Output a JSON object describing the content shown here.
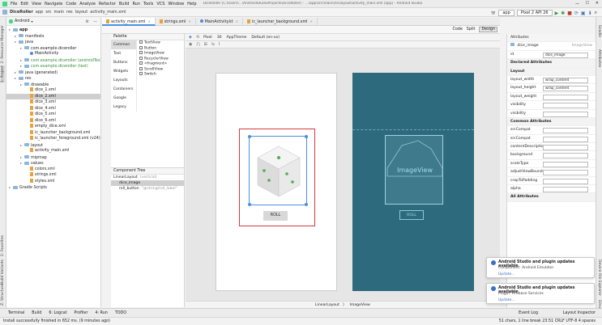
{
  "window_title": "DiceRoller [C:\\Users\\...\\AndroidStudioProjects\\DiceRoller] - ...\\app\\src\\main\\res\\layout\\activity_main.xml [app] - Android Studio",
  "menu": [
    "File",
    "Edit",
    "View",
    "Navigate",
    "Code",
    "Analyze",
    "Refactor",
    "Build",
    "Run",
    "Tools",
    "VCS",
    "Window",
    "Help"
  ],
  "breadcrumbs": [
    "DiceRoller",
    "app",
    "src",
    "main",
    "res",
    "layout",
    "activity_main.xml"
  ],
  "toolbar": {
    "run_config": "app",
    "device": "Pixel 2 API 26"
  },
  "project_panel": {
    "view_mode": "Android",
    "tree": [
      {
        "label": "app",
        "indent": 0,
        "kind": "folder",
        "bold": true
      },
      {
        "label": "manifests",
        "indent": 1,
        "kind": "folder"
      },
      {
        "label": "java",
        "indent": 1,
        "kind": "folder"
      },
      {
        "label": "com.example.diceroller",
        "indent": 2,
        "kind": "folder"
      },
      {
        "label": "MainActivity",
        "indent": 3,
        "kind": "kt"
      },
      {
        "label": "com.example.diceroller (androidTest)",
        "indent": 2,
        "kind": "folder",
        "green": true
      },
      {
        "label": "com.example.diceroller (test)",
        "indent": 2,
        "kind": "folder",
        "green": true
      },
      {
        "label": "java (generated)",
        "indent": 1,
        "kind": "folder"
      },
      {
        "label": "res",
        "indent": 1,
        "kind": "folder"
      },
      {
        "label": "drawable",
        "indent": 2,
        "kind": "folder"
      },
      {
        "label": "dice_1.xml",
        "indent": 3,
        "kind": "xml"
      },
      {
        "label": "dice_2.xml",
        "indent": 3,
        "kind": "xml",
        "selected": true
      },
      {
        "label": "dice_3.xml",
        "indent": 3,
        "kind": "xml"
      },
      {
        "label": "dice_4.xml",
        "indent": 3,
        "kind": "xml"
      },
      {
        "label": "dice_5.xml",
        "indent": 3,
        "kind": "xml"
      },
      {
        "label": "dice_6.xml",
        "indent": 3,
        "kind": "xml"
      },
      {
        "label": "empty_dice.xml",
        "indent": 3,
        "kind": "xml"
      },
      {
        "label": "ic_launcher_background.xml",
        "indent": 3,
        "kind": "xml"
      },
      {
        "label": "ic_launcher_foreground.xml (v24)",
        "indent": 3,
        "kind": "xml"
      },
      {
        "label": "layout",
        "indent": 2,
        "kind": "folder"
      },
      {
        "label": "activity_main.xml",
        "indent": 3,
        "kind": "xml"
      },
      {
        "label": "mipmap",
        "indent": 2,
        "kind": "folder"
      },
      {
        "label": "values",
        "indent": 2,
        "kind": "folder"
      },
      {
        "label": "colors.xml",
        "indent": 3,
        "kind": "xml"
      },
      {
        "label": "strings.xml",
        "indent": 3,
        "kind": "xml"
      },
      {
        "label": "styles.xml",
        "indent": 3,
        "kind": "xml"
      },
      {
        "label": "Gradle Scripts",
        "indent": 0,
        "kind": "folder"
      }
    ]
  },
  "editor_tabs": [
    {
      "label": "activity_main.xml",
      "active": true
    },
    {
      "label": "strings.xml"
    },
    {
      "label": "MainActivity.kt"
    },
    {
      "label": "ic_launcher_background.xml"
    }
  ],
  "view_modes": [
    "Code",
    "Split",
    "Design"
  ],
  "palette": {
    "title": "Palette",
    "categories": [
      "Common",
      "Text",
      "Buttons",
      "Widgets",
      "Layouts",
      "Containers",
      "Google",
      "Legacy"
    ],
    "items": [
      "TextView",
      "Button",
      "ImageView",
      "RecyclerView",
      "<fragment>",
      "ScrollView",
      "Switch"
    ]
  },
  "design_toolbar": {
    "orientation": "Pixel",
    "api": "30",
    "theme": "AppTheme",
    "locale": "Default (en-us)"
  },
  "component_tree": {
    "title": "Component Tree",
    "nodes": [
      {
        "label": "LinearLayout",
        "suffix": "(vertical)"
      },
      {
        "label": "dice_image",
        "selected": true
      },
      {
        "label": "roll_button",
        "suffix": "\"@string/roll_label\""
      }
    ]
  },
  "preview": {
    "roll_label": "ROLL",
    "blueprint_label": "ImageView",
    "blueprint_roll": "ROLL"
  },
  "breadcrumb_bottom": [
    "LinearLayout",
    "ImageView"
  ],
  "attributes": {
    "title": "Attributes",
    "component": "dice_image",
    "type": "ImageView",
    "id_label": "id",
    "id_value": "dice_image",
    "declared_title": "Declared Attributes",
    "layout_title": "Layout",
    "layout_rows": [
      {
        "name": "layout_width",
        "value": "wrap_content"
      },
      {
        "name": "layout_height",
        "value": "wrap_content"
      },
      {
        "name": "layout_weight",
        "value": ""
      },
      {
        "name": "visibility",
        "value": ""
      },
      {
        "name": "visibility",
        "value": ""
      }
    ],
    "common_title": "Common Attributes",
    "common_rows": [
      {
        "name": "srcCompat",
        "value": ""
      },
      {
        "name": "srcCompat",
        "value": ""
      },
      {
        "name": "contentDescription",
        "value": ""
      },
      {
        "name": "background",
        "value": ""
      },
      {
        "name": "scaleType",
        "value": ""
      },
      {
        "name": "adjustViewBounds",
        "value": ""
      },
      {
        "name": "cropToPadding",
        "value": ""
      },
      {
        "name": "alpha",
        "value": ""
      }
    ],
    "all_title": "All Attributes"
  },
  "notifications": [
    {
      "title": "Android Studio and plugin updates available",
      "body": "Component: Android Emulator",
      "link": "Update..."
    },
    {
      "title": "Android Studio and plugin updates available",
      "body": "Plugin: Firebase Services",
      "link": "Update..."
    }
  ],
  "bottom_tabs": [
    "Terminal",
    "Build",
    "6: Logcat",
    "Profiler",
    "4: Run",
    "TODO"
  ],
  "bottom_right": [
    "Event Log",
    "Layout Inspector"
  ],
  "status": {
    "message": "Install successfully finished in 652 ms. (9 minutes ago)",
    "info": "51 chars, 1 line break   23:51   CRLF   UTF-8   4 spaces"
  },
  "side_left": [
    "1: Project",
    "2: Resource Manager",
    "Z: Structure",
    "2: Favorites",
    "Build Variants"
  ],
  "side_right": [
    "Gradle",
    "Attributes",
    "Device File Explorer",
    "Emulator"
  ],
  "colors": {
    "accent": "#4a90e2",
    "selection_red": "#d23b3b",
    "blueprint": "#2e6a7d",
    "die_green": "#4caf50"
  }
}
